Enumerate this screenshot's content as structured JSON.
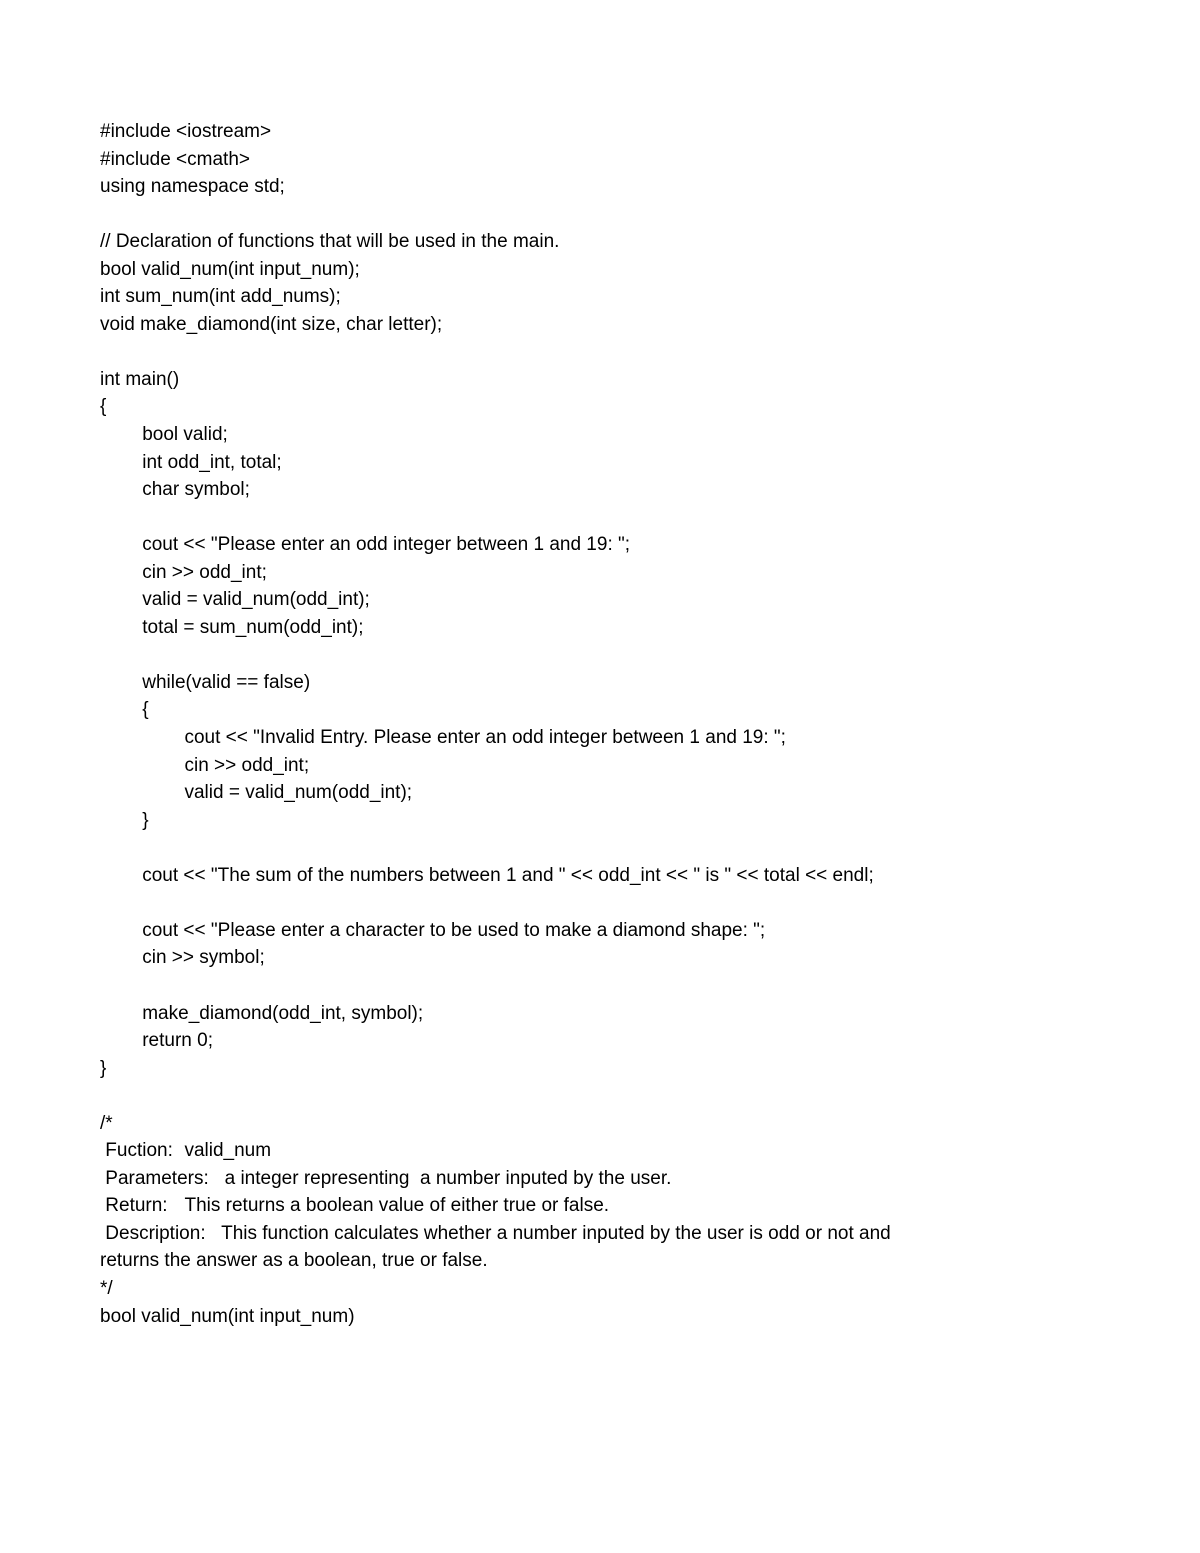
{
  "code": "#include <iostream>\n#include <cmath>\nusing namespace std;\n\n// Declaration of functions that will be used in the main.\nbool valid_num(int input_num);\nint sum_num(int add_nums);\nvoid make_diamond(int size, char letter);\n\nint main()\n{\n\tbool valid;\n\tint odd_int, total;\n\tchar symbol;\n\n\tcout << \"Please enter an odd integer between 1 and 19: \";\n\tcin >> odd_int;\n\tvalid = valid_num(odd_int);\n\ttotal = sum_num(odd_int);\n\n\twhile(valid == false)\n\t{\n\t\tcout << \"Invalid Entry. Please enter an odd integer between 1 and 19: \";\n\t\tcin >> odd_int;\n\t\tvalid = valid_num(odd_int);\n\t}\n\n\tcout << \"The sum of the numbers between 1 and \" << odd_int << \" is \" << total << endl;\n\n\tcout << \"Please enter a character to be used to make a diamond shape: \";\n\tcin >> symbol;\n\n\tmake_diamond(odd_int, symbol);\n\treturn 0;\n}\n\n/*\n Fuction:\tvalid_num\n Parameters:   a integer representing  a number inputed by the user.\n Return:\tThis returns a boolean value of either true or false.\n Description:   This function calculates whether a number inputed by the user is odd or not and\nreturns the answer as a boolean, true or false.\n*/\nbool valid_num(int input_num)"
}
